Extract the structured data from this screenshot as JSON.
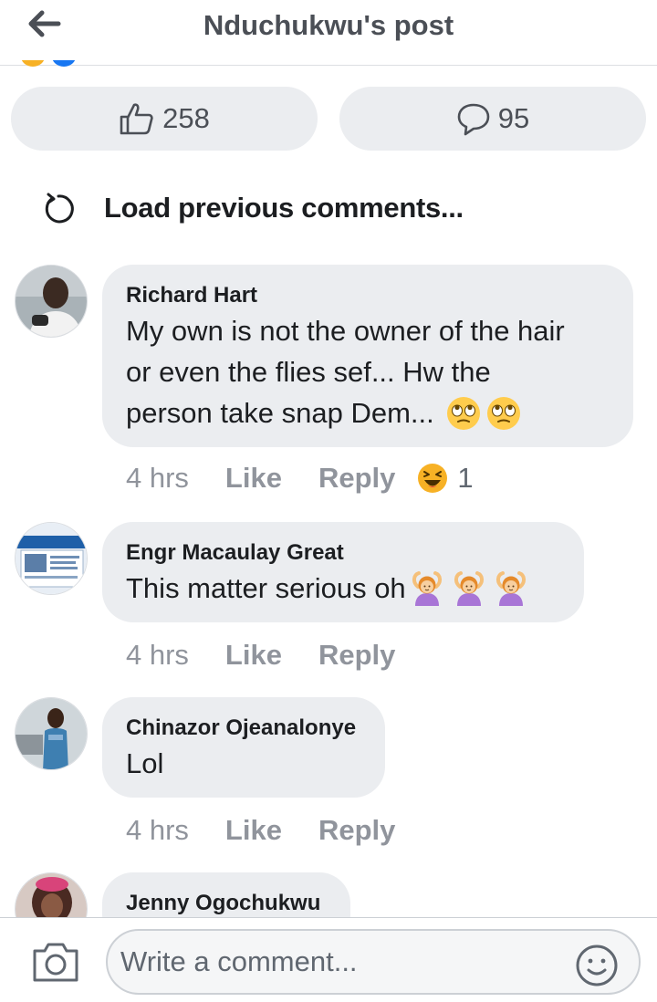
{
  "header": {
    "title": "Nduchukwu's post",
    "back_icon": "arrow-left-icon"
  },
  "stats": {
    "likes": "258",
    "comments": "95"
  },
  "load_previous": {
    "label": "Load previous comments..."
  },
  "comments": [
    {
      "author": "Richard Hart",
      "text_lines": [
        "My own is not the owner of the hair",
        "or even the flies sef... Hw the",
        "person take snap Dem..."
      ],
      "time": "4 hrs",
      "like": "Like",
      "reply": "Reply",
      "reaction": {
        "icon": "laughing-face-icon",
        "count": "1"
      }
    },
    {
      "author": "Engr Macaulay Great",
      "text": "This matter serious oh",
      "time": "4 hrs",
      "like": "Like",
      "reply": "Reply"
    },
    {
      "author": "Chinazor Ojeanalonye",
      "text": "Lol",
      "time": "4 hrs",
      "like": "Like",
      "reply": "Reply"
    },
    {
      "author": "Jenny Ogochukwu"
    }
  ],
  "composer": {
    "placeholder": "Write a comment..."
  },
  "colors": {
    "bubble": "#ebedf0",
    "muted": "#90949c",
    "text": "#1c1e21"
  }
}
